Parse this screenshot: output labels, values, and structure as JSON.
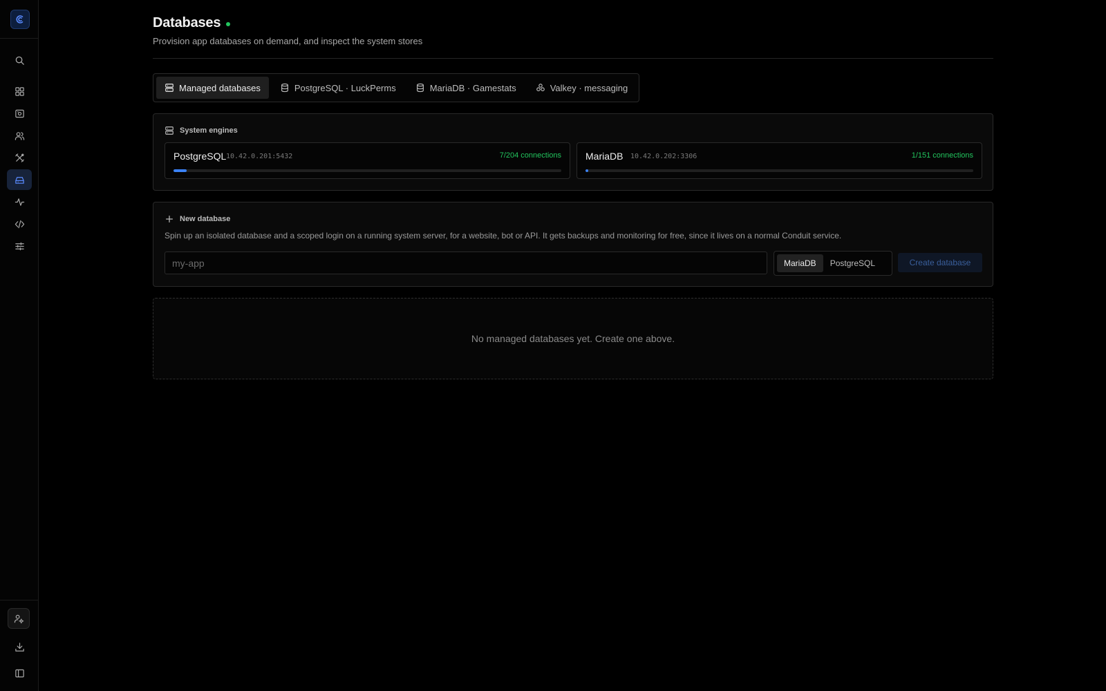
{
  "colors": {
    "accent": "#3b82f6",
    "success": "#22c55e",
    "background": "#000000"
  },
  "sidebar": {
    "logo_icon": "conduit-logo-icon",
    "items": [
      {
        "name": "search",
        "icon": "search-icon"
      },
      {
        "name": "dashboard",
        "icon": "grid-icon"
      },
      {
        "name": "servers",
        "icon": "server-icon"
      },
      {
        "name": "users",
        "icon": "users-icon"
      },
      {
        "name": "tools",
        "icon": "tools-icon"
      },
      {
        "name": "databases",
        "icon": "database-icon",
        "active": true
      },
      {
        "name": "activity",
        "icon": "activity-icon"
      },
      {
        "name": "code",
        "icon": "code-icon"
      },
      {
        "name": "settings",
        "icon": "sliders-icon"
      }
    ],
    "bottom": [
      {
        "name": "account",
        "icon": "user-cog-icon"
      },
      {
        "name": "download",
        "icon": "download-icon"
      },
      {
        "name": "collapse",
        "icon": "panel-icon"
      }
    ]
  },
  "header": {
    "title": "Databases",
    "subtitle": "Provision app databases on demand, and inspect the system stores"
  },
  "tabs": [
    {
      "label": "Managed databases",
      "icon": "database-stack-icon",
      "active": true
    },
    {
      "label": "PostgreSQL · LuckPerms",
      "icon": "database-icon"
    },
    {
      "label": "MariaDB · Gamestats",
      "icon": "database-icon"
    },
    {
      "label": "Valkey · messaging",
      "icon": "cluster-icon"
    }
  ],
  "system_engines": {
    "label": "System engines",
    "engines": [
      {
        "name": "PostgreSQL",
        "host": "10.42.0.201:5432",
        "connections": "7/204 connections",
        "usage_fraction": 0.0343
      },
      {
        "name": "MariaDB",
        "host": "10.42.0.202:3306",
        "connections": "1/151 connections",
        "usage_fraction": 0.0066
      }
    ]
  },
  "new_database": {
    "label": "New database",
    "description": "Spin up an isolated database and a scoped login on a running system server, for a website, bot or API. It gets backups and monitoring for free, since it lives on a normal Conduit service.",
    "input_placeholder": "my-app",
    "input_value": "",
    "engine_options": [
      "MariaDB",
      "PostgreSQL"
    ],
    "selected_engine": "MariaDB",
    "create_label": "Create database"
  },
  "empty_state": "No managed databases yet. Create one above."
}
